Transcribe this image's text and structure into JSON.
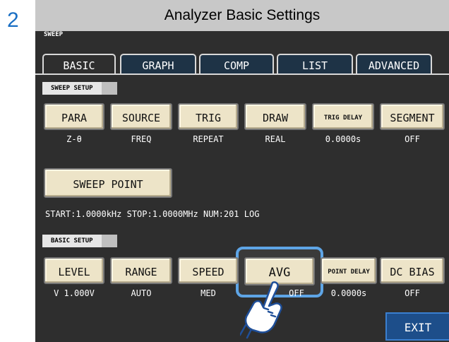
{
  "step_number": "2",
  "title": "Analyzer Basic Settings",
  "sweep_label": "SWEEP",
  "tabs": [
    "BASIC",
    "GRAPH",
    "COMP",
    "LIST",
    "ADVANCED"
  ],
  "active_tab": "BASIC",
  "sweep_setup": {
    "header": "SWEEP SETUP",
    "buttons": [
      {
        "label": "PARA",
        "value": "Z-θ"
      },
      {
        "label": "SOURCE",
        "value": "FREQ"
      },
      {
        "label": "TRIG",
        "value": "REPEAT"
      },
      {
        "label": "DRAW",
        "value": "REAL"
      },
      {
        "label": "TRIG DELAY",
        "value": "0.0000s"
      },
      {
        "label": "SEGMENT",
        "value": "OFF"
      }
    ],
    "sweep_point_label": "SWEEP POINT",
    "sweep_point_info": "START:1.0000kHz STOP:1.0000MHz NUM:201 LOG"
  },
  "basic_setup": {
    "header": "BASIC SETUP",
    "buttons": [
      {
        "label": "LEVEL",
        "value": "V 1.000V"
      },
      {
        "label": "RANGE",
        "value": "AUTO"
      },
      {
        "label": "SPEED",
        "value": "MED"
      },
      {
        "label": "AVG",
        "value": "OFF"
      },
      {
        "label": "POINT DELAY",
        "value": "0.0000s"
      },
      {
        "label": "DC BIAS",
        "value": "OFF"
      }
    ]
  },
  "exit_label": "EXIT",
  "colors": {
    "screen_bg": "#2e2e2e",
    "button_face": "#ede4c8",
    "highlight": "#5ea5e6",
    "exit_bg": "#1d4e8a",
    "step_number": "#1a6fc4"
  }
}
